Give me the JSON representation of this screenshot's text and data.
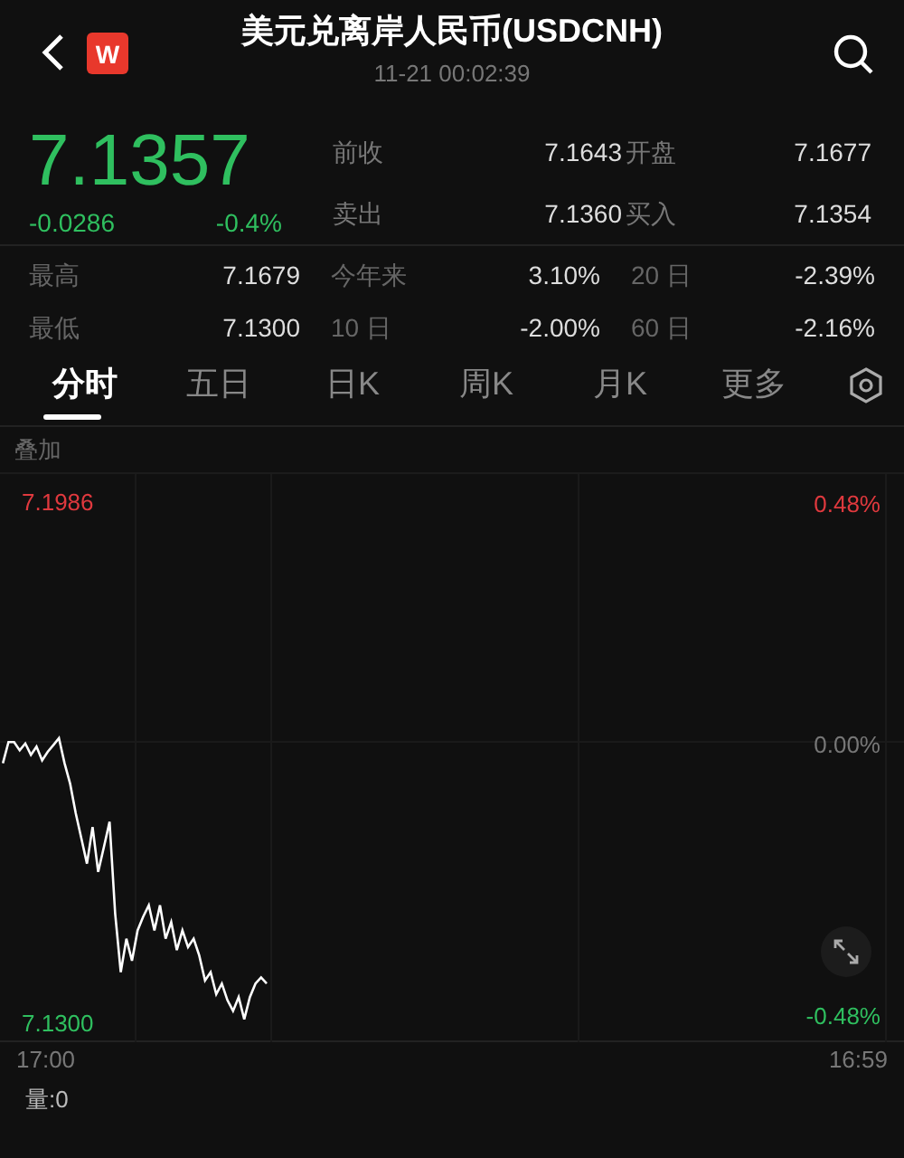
{
  "header": {
    "badge": "W",
    "title": "美元兑离岸人民币(USDCNH)",
    "time": "11-21 00:02:39"
  },
  "quote": {
    "price": "7.1357",
    "change": "-0.0286",
    "change_pct": "-0.4%"
  },
  "quote_stats": [
    {
      "label": "前收",
      "value": "7.1643"
    },
    {
      "label": "开盘",
      "value": "7.1677"
    },
    {
      "label": "卖出",
      "value": "7.1360"
    },
    {
      "label": "买入",
      "value": "7.1354"
    }
  ],
  "stats": [
    {
      "label": "最高",
      "value": "7.1679"
    },
    {
      "label": "今年来",
      "value": "3.10%"
    },
    {
      "label": "20 日",
      "value": "-2.39%"
    },
    {
      "label": "最低",
      "value": "7.1300"
    },
    {
      "label": "10 日",
      "value": "-2.00%"
    },
    {
      "label": "60 日",
      "value": "-2.16%"
    }
  ],
  "tabs": [
    {
      "label": "分时",
      "selected": true
    },
    {
      "label": "五日",
      "selected": false
    },
    {
      "label": "日K",
      "selected": false
    },
    {
      "label": "周K",
      "selected": false
    },
    {
      "label": "月K",
      "selected": false
    },
    {
      "label": "更多",
      "selected": false
    }
  ],
  "overlay": "叠加",
  "chart": {
    "start_time": "17:00",
    "end_time": "16:59",
    "top_pct": "0.48%",
    "mid_pct": "0.00%",
    "bottom_pct": "-0.48%",
    "chart_data": {
      "type": "line",
      "categories": [
        null,
        null,
        null,
        null,
        null,
        null,
        null,
        null,
        null,
        null,
        null,
        null,
        null,
        null,
        null,
        null,
        null,
        null,
        null,
        null,
        null,
        null,
        null,
        null,
        null,
        null,
        null,
        null,
        null,
        null,
        null,
        null,
        null,
        null,
        null,
        null,
        null,
        null,
        null,
        null,
        null,
        null,
        null,
        null,
        null,
        null,
        null,
        null,
        null,
        null,
        null,
        null,
        null,
        null,
        null,
        null,
        null,
        null,
        null,
        null,
        null,
        null,
        null,
        null,
        null,
        null,
        null,
        null,
        null,
        null,
        null,
        null,
        null,
        null,
        null,
        null,
        null,
        null,
        null,
        null,
        null,
        null,
        null,
        null,
        null,
        null,
        null,
        null,
        null,
        null,
        null,
        null,
        null,
        null,
        null,
        null,
        null,
        null,
        null,
        null,
        null,
        null,
        null,
        null,
        null,
        null,
        null,
        null,
        null,
        null,
        null,
        null,
        null,
        null,
        null,
        null,
        null,
        null,
        null,
        null,
        null,
        null,
        null,
        null,
        null,
        null,
        null,
        null,
        null,
        null,
        null,
        null,
        null,
        null,
        null,
        null,
        null,
        null,
        null,
        null,
        null,
        null,
        null,
        null,
        null,
        null,
        null,
        null,
        null,
        null,
        null,
        null,
        null,
        null,
        null,
        null,
        null,
        null,
        null,
        null,
        null
      ],
      "series": [
        {
          "color": "#ffffff",
          "values": [
            7.1641,
            7.1669,
            7.1669,
            7.1658,
            7.1667,
            7.1652,
            7.1663,
            7.1645,
            7.1656,
            7.1665,
            7.1674,
            7.1641,
            7.1614,
            7.1575,
            7.1542,
            7.1509,
            7.1557,
            7.1498,
            7.1531,
            7.1564,
            7.1443,
            7.1366,
            7.141,
            7.1381,
            7.1421,
            7.1439,
            7.1454,
            7.1421,
            7.1454,
            7.141,
            7.1432,
            7.1395,
            7.1421,
            7.1399,
            7.141,
            7.1388,
            7.1355,
            7.1366,
            7.1337,
            7.1351,
            7.1329,
            7.1315,
            7.1333,
            7.1304,
            7.1333,
            7.1351,
            7.1359,
            7.1351,
            null,
            null,
            null,
            null,
            null,
            null,
            null,
            null,
            null,
            null,
            null,
            null,
            null,
            null,
            null,
            null,
            null,
            null,
            null,
            null,
            null,
            null,
            null,
            null,
            null,
            null,
            null,
            null,
            null,
            null,
            null,
            null,
            null,
            null,
            null,
            null,
            null,
            null,
            null,
            null,
            null,
            null,
            null,
            null,
            null,
            null,
            null,
            null,
            null,
            null,
            null,
            null,
            null,
            null,
            null,
            null,
            null,
            null,
            null,
            null,
            null,
            null,
            null,
            null,
            null,
            null,
            null,
            null,
            null,
            null,
            null,
            null,
            null,
            null,
            null,
            null,
            null,
            null,
            null,
            null,
            null,
            null,
            null,
            null,
            null,
            null,
            null,
            null,
            null,
            null,
            null,
            null,
            null,
            null,
            null,
            null,
            null,
            null,
            null,
            null,
            null,
            null,
            null,
            null,
            null,
            null,
            null,
            null,
            null,
            null,
            null,
            null,
            null
          ]
        }
      ],
      "ylim": [
        7.13,
        7.1986
      ],
      "yticks": [
        {
          "value": 7.1986,
          "label": "7.1986"
        },
        {
          "value": 7.13,
          "label": "7.1300"
        }
      ]
    }
  },
  "volume": "量:0"
}
